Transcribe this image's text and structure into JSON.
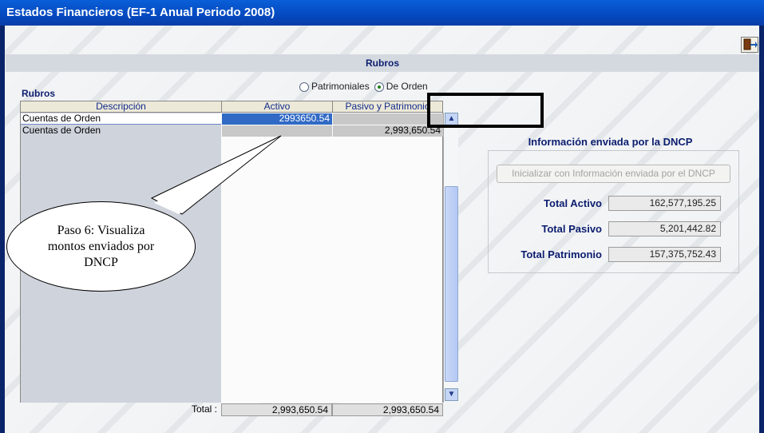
{
  "window": {
    "title": "Estados Financieros (EF-1 Anual Periodo 2008)"
  },
  "toolbar": {
    "exit_icon": "exit-door-icon"
  },
  "section": {
    "band_title": "Rubros",
    "grid_label": "Rubros"
  },
  "radios": [
    {
      "label": "Patrimoniales",
      "checked": false
    },
    {
      "label": "De Orden",
      "checked": true
    }
  ],
  "grid": {
    "columns": [
      "Descripción",
      "Activo",
      "Pasivo y Patrimonio"
    ],
    "rows": [
      {
        "descripcion": "Cuentas de Orden",
        "activo": "2993650.54",
        "pasivo": ""
      },
      {
        "descripcion": "Cuentas de Orden",
        "activo": "",
        "pasivo": "2,993,650.54"
      }
    ],
    "total_label": "Total :",
    "total_activo": "2,993,650.54",
    "total_pasivo": "2,993,650.54"
  },
  "callout": {
    "text": "Paso 6: Visualiza montos enviados por DNCP"
  },
  "dncp": {
    "title": "Información enviada por la DNCP",
    "init_button": "Inicializar con Información enviada por el DNCP",
    "total_activo_label": "Total Activo",
    "total_activo": "162,577,195.25",
    "total_pasivo_label": "Total Pasivo",
    "total_pasivo": "5,201,442.82",
    "total_patrimonio_label": "Total Patrimonio",
    "total_patrimonio": "157,375,752.43"
  },
  "colors": {
    "title_bar": "#0449c0",
    "selected_cell": "#316ac5",
    "label_blue": "#0b1d6e"
  }
}
